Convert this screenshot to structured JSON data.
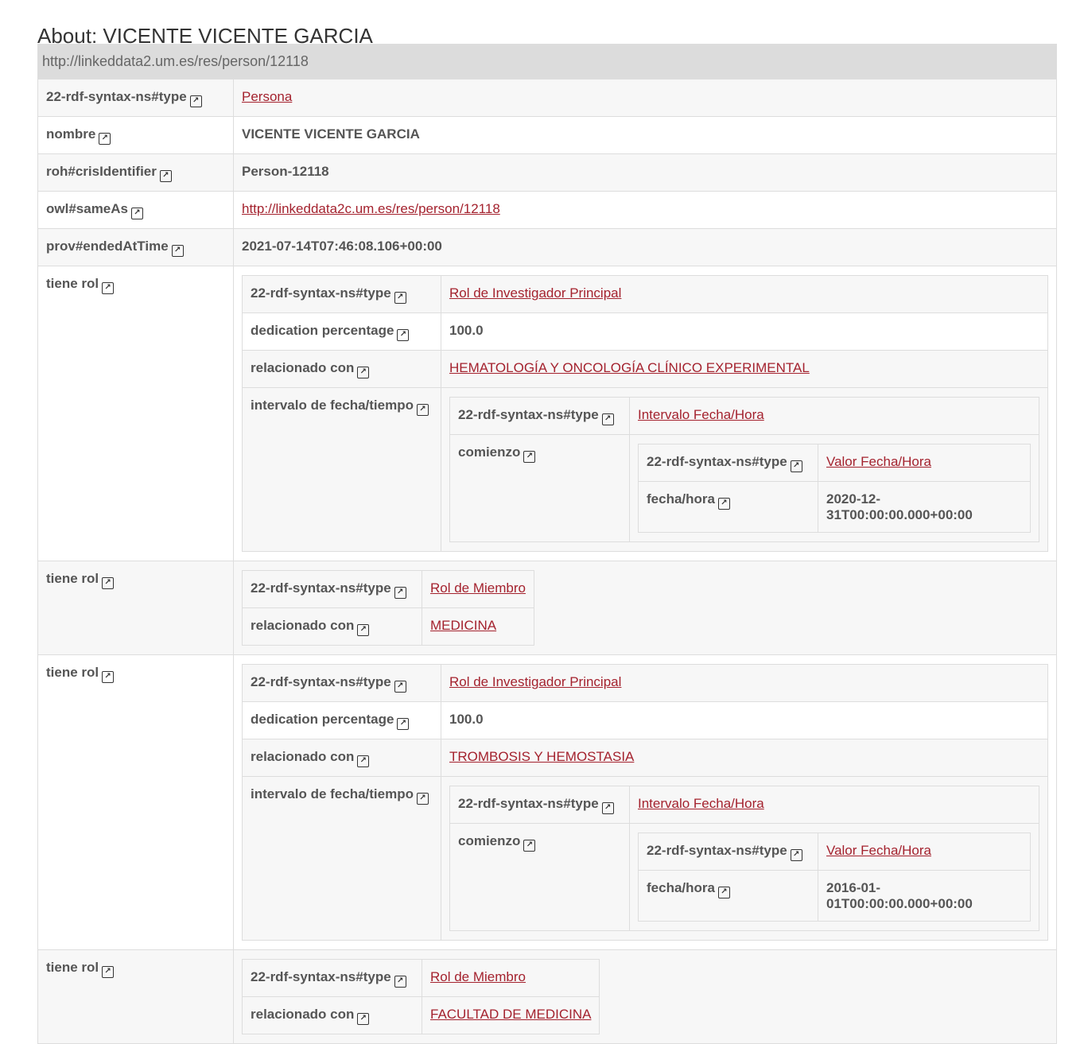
{
  "page_title": "About: VICENTE VICENTE GARCIA",
  "subject_uri": "http://linkeddata2.um.es/res/person/12118",
  "props": {
    "type": {
      "key": "22-rdf-syntax-ns#type",
      "value": "Persona"
    },
    "nombre": {
      "key": "nombre",
      "value": "VICENTE VICENTE GARCIA"
    },
    "cris": {
      "key": "roh#crisIdentifier",
      "value": "Person-12118"
    },
    "sameas": {
      "key": "owl#sameAs",
      "value": "http://linkeddata2c.um.es/res/person/12118"
    },
    "ended": {
      "key": "prov#endedAtTime",
      "value": "2021-07-14T07:46:08.106+00:00"
    }
  },
  "roles": [
    {
      "key": "tiene rol",
      "type": {
        "key": "22-rdf-syntax-ns#type",
        "value": "Rol de Investigador Principal"
      },
      "dedication": {
        "key": "dedication percentage",
        "value": "100.0"
      },
      "related": {
        "key": "relacionado con",
        "value": "HEMATOLOGÍA Y ONCOLOGÍA CLÍNICO EXPERIMENTAL"
      },
      "interval": {
        "key": "intervalo de fecha/tiempo",
        "type": {
          "key": "22-rdf-syntax-ns#type",
          "value": "Intervalo Fecha/Hora"
        },
        "start": {
          "key": "comienzo",
          "type": {
            "key": "22-rdf-syntax-ns#type",
            "value": "Valor Fecha/Hora"
          },
          "datetime": {
            "key": "fecha/hora",
            "value": "2020-12-31T00:00:00.000+00:00"
          }
        }
      }
    },
    {
      "key": "tiene rol",
      "type": {
        "key": "22-rdf-syntax-ns#type",
        "value": "Rol de Miembro"
      },
      "related": {
        "key": "relacionado con",
        "value": "MEDICINA"
      }
    },
    {
      "key": "tiene rol",
      "type": {
        "key": "22-rdf-syntax-ns#type",
        "value": "Rol de Investigador Principal"
      },
      "dedication": {
        "key": "dedication percentage",
        "value": "100.0"
      },
      "related": {
        "key": "relacionado con",
        "value": "TROMBOSIS Y HEMOSTASIA"
      },
      "interval": {
        "key": "intervalo de fecha/tiempo",
        "type": {
          "key": "22-rdf-syntax-ns#type",
          "value": "Intervalo Fecha/Hora"
        },
        "start": {
          "key": "comienzo",
          "type": {
            "key": "22-rdf-syntax-ns#type",
            "value": "Valor Fecha/Hora"
          },
          "datetime": {
            "key": "fecha/hora",
            "value": "2016-01-01T00:00:00.000+00:00"
          }
        }
      }
    },
    {
      "key": "tiene rol",
      "type": {
        "key": "22-rdf-syntax-ns#type",
        "value": "Rol de Miembro"
      },
      "related": {
        "key": "relacionado con",
        "value": "FACULTAD DE MEDICINA"
      }
    }
  ],
  "icons": {
    "external_link": "external-link-icon",
    "glyph": "↗"
  },
  "colors": {
    "link": "#a4222e",
    "header_bg": "#dcdcdc",
    "alt_row": "#f7f7f7",
    "border": "#dddddd"
  }
}
